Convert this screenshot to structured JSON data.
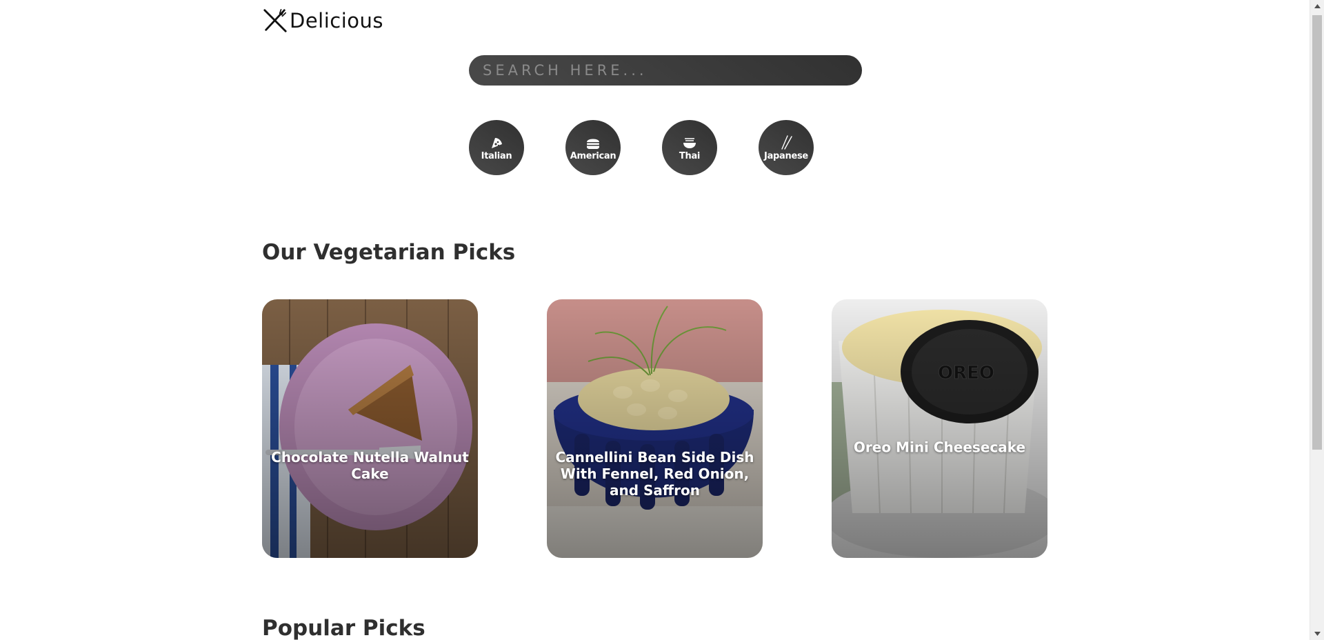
{
  "logo": {
    "text": "Delicious",
    "icon": "fork-knife-icon"
  },
  "search": {
    "placeholder": "SEARCH HERE...",
    "value": ""
  },
  "categories": [
    {
      "label": "Italian",
      "icon": "pizza-icon"
    },
    {
      "label": "American",
      "icon": "burger-icon"
    },
    {
      "label": "Thai",
      "icon": "noodle-bowl-icon"
    },
    {
      "label": "Japanese",
      "icon": "chopsticks-icon"
    }
  ],
  "sections": {
    "vegetarian": {
      "title": "Our Vegetarian Picks"
    },
    "popular": {
      "title": "Popular Picks"
    }
  },
  "vegetarian_cards": [
    {
      "title": "Chocolate Nutella Walnut Cake"
    },
    {
      "title": "Cannellini Bean Side Dish With Fennel, Red Onion, and Saffron"
    },
    {
      "title": "Oreo Mini Cheesecake"
    }
  ],
  "colors": {
    "accent_dark": "#313131",
    "accent_light": "#494949",
    "text": "#2f2f2f"
  }
}
